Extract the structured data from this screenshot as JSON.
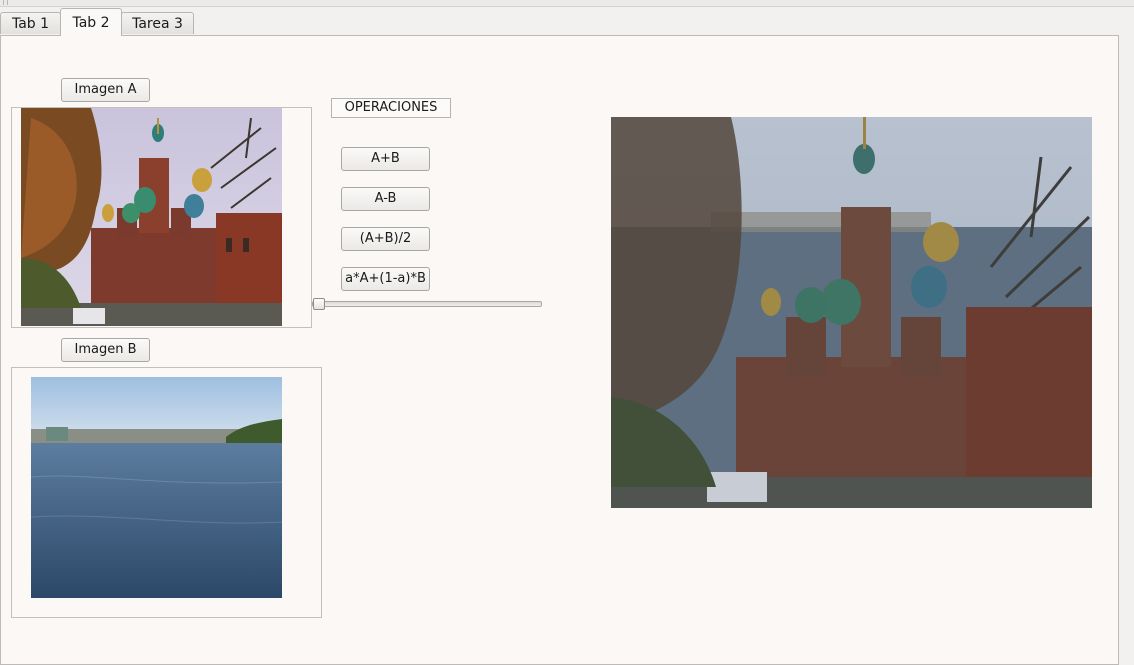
{
  "tabs": [
    {
      "label": "Tab 1",
      "active": false
    },
    {
      "label": "Tab 2",
      "active": true
    },
    {
      "label": "Tarea 3",
      "active": false
    }
  ],
  "image_a": {
    "button_label": "Imagen A",
    "description": "church with onion domes and trees"
  },
  "image_b": {
    "button_label": "Imagen B",
    "description": "river landscape under blue sky"
  },
  "operations": {
    "title": "OPERACIONES",
    "buttons": [
      "A+B",
      "A-B",
      "(A+B)/2",
      "a*A+(1-a)*B"
    ]
  },
  "alpha_slider": {
    "value": 0.0
  },
  "result": {
    "description": "blended result of image A and image B"
  },
  "colors": {
    "panel": "#fcf8f5",
    "window": "#f2f1f0"
  }
}
